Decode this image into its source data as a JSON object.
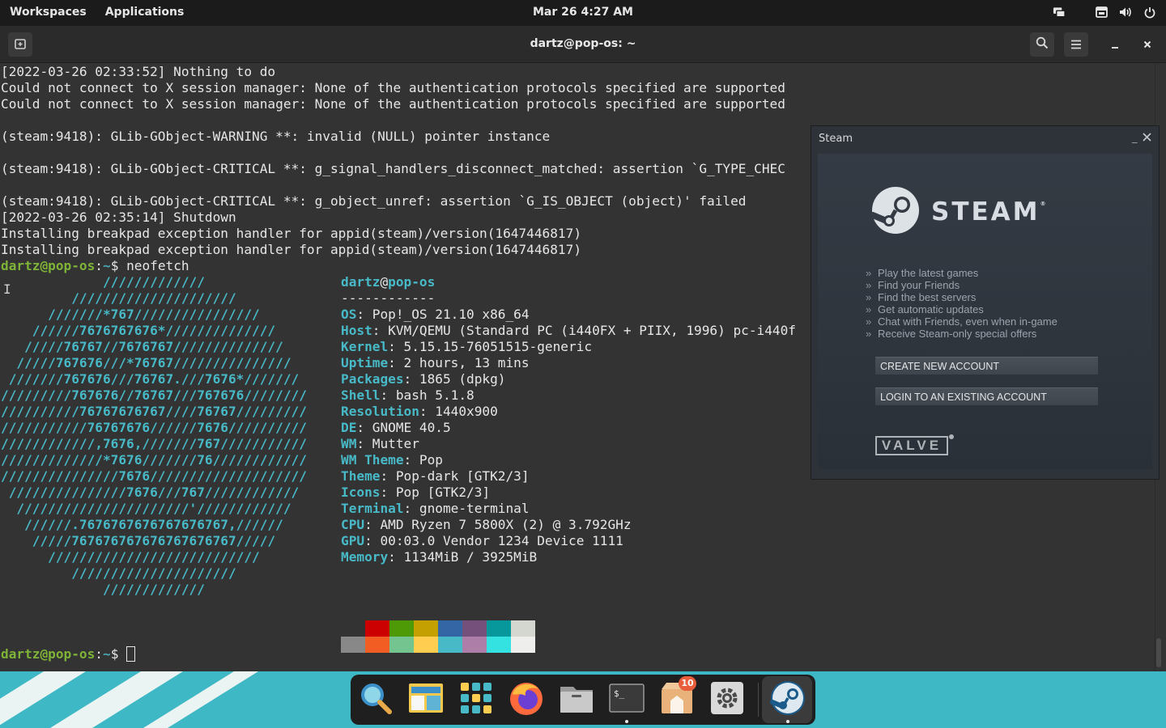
{
  "topbar": {
    "workspaces": "Workspaces",
    "applications": "Applications",
    "clock": "Mar 26  4:27 AM",
    "tray_icons": [
      "notification-icon",
      "keyboard-layout-icon",
      "volume-icon",
      "power-icon"
    ]
  },
  "terminal": {
    "title": "dartz@pop-os: ~",
    "log_lines": [
      "[2022-03-26 02:33:52] Nothing to do",
      "Could not connect to X session manager: None of the authentication protocols specified are supported",
      "Could not connect to X session manager: None of the authentication protocols specified are supported",
      "",
      "(steam:9418): GLib-GObject-WARNING **: invalid (NULL) pointer instance",
      "",
      "(steam:9418): GLib-GObject-CRITICAL **: g_signal_handlers_disconnect_matched: assertion `G_TYPE_CHEC",
      "",
      "(steam:9418): GLib-GObject-CRITICAL **: g_object_unref: assertion `G_IS_OBJECT (object)' failed",
      "[2022-03-26 02:35:14] Shutdown",
      "Installing breakpad exception handler for appid(steam)/version(1647446817)",
      "Installing breakpad exception handler for appid(steam)/version(1647446817)"
    ],
    "prompt_user": "dartz@pop-os",
    "prompt_sep": ":",
    "prompt_path": "~",
    "prompt_symbol": "$ ",
    "command": "neofetch",
    "ascii_art": [
      "             /////////////",
      "         /////////////////////",
      "      ///////*767////////////////",
      "    //////7676767676*//////////////",
      "   /////76767//7676767//////////////",
      "  /////767676///*76767///////////////",
      " ///////767676///76767.///7676*///////",
      "/////////767676//76767///767676////////",
      "//////////76767676767////76767/////////",
      "///////////76767676//////7676//////////",
      "////////////,7676,///////767///////////",
      "/////////////*7676///////76////////////",
      "///////////////7676////////////////////",
      " ///////////////7676///767////////////",
      "  //////////////////////'////////////",
      "   //////.7676767676767676767,//////",
      "    /////767676767676767676767/////",
      "      ///////////////////////////",
      "         /////////////////////",
      "             /////////////"
    ],
    "neofetch_user": "dartz",
    "neofetch_at": "@",
    "neofetch_host": "pop-os",
    "neofetch_divider": "------------",
    "info": [
      {
        "key": "OS",
        "value": ": Pop!_OS 21.10 x86_64"
      },
      {
        "key": "Host",
        "value": ": KVM/QEMU (Standard PC (i440FX + PIIX, 1996) pc-i440f"
      },
      {
        "key": "Kernel",
        "value": ": 5.15.15-76051515-generic"
      },
      {
        "key": "Uptime",
        "value": ": 2 hours, 13 mins"
      },
      {
        "key": "Packages",
        "value": ": 1865 (dpkg)"
      },
      {
        "key": "Shell",
        "value": ": bash 5.1.8"
      },
      {
        "key": "Resolution",
        "value": ": 1440x900"
      },
      {
        "key": "DE",
        "value": ": GNOME 40.5"
      },
      {
        "key": "WM",
        "value": ": Mutter"
      },
      {
        "key": "WM Theme",
        "value": ": Pop"
      },
      {
        "key": "Theme",
        "value": ": Pop-dark [GTK2/3]"
      },
      {
        "key": "Icons",
        "value": ": Pop [GTK2/3]"
      },
      {
        "key": "Terminal",
        "value": ": gnome-terminal"
      },
      {
        "key": "CPU",
        "value": ": AMD Ryzen 7 5800X (2) @ 3.792GHz"
      },
      {
        "key": "GPU",
        "value": ": 00:03.0 Vendor 1234 Device 1111"
      },
      {
        "key": "Memory",
        "value": ": 1134MiB / 3925MiB"
      }
    ],
    "palette_top": [
      "#333333",
      "#cc0000",
      "#4e9a06",
      "#c4a000",
      "#3465a4",
      "#75507b",
      "#06989a",
      "#d3d7cf"
    ],
    "palette_bottom": [
      "#888888",
      "#f15d22",
      "#73c48f",
      "#ffce51",
      "#48b9c7",
      "#ad7fa8",
      "#34e2e2",
      "#eeeeec"
    ]
  },
  "steam": {
    "window_title": "Steam",
    "wordmark": "STEAM",
    "features": [
      "Play the latest games",
      "Find your Friends",
      "Find the best servers",
      "Get automatic updates",
      "Chat with Friends, even when in-game",
      "Receive Steam-only special offers"
    ],
    "create_account": "CREATE NEW ACCOUNT",
    "login": "LOGIN TO AN EXISTING ACCOUNT",
    "valve": "VALVE"
  },
  "dock": {
    "items": [
      "search-icon",
      "workspaces-icon",
      "app-grid-icon",
      "firefox-icon",
      "files-icon",
      "terminal-icon",
      "store-icon",
      "settings-icon",
      "steam-icon"
    ],
    "store_badge": "10"
  },
  "colors": {
    "terminal_bg": "#333333",
    "pop_teal": "#48b9c7",
    "prompt_green": "#7eb338",
    "desktop_teal": "#3fb8c6"
  }
}
